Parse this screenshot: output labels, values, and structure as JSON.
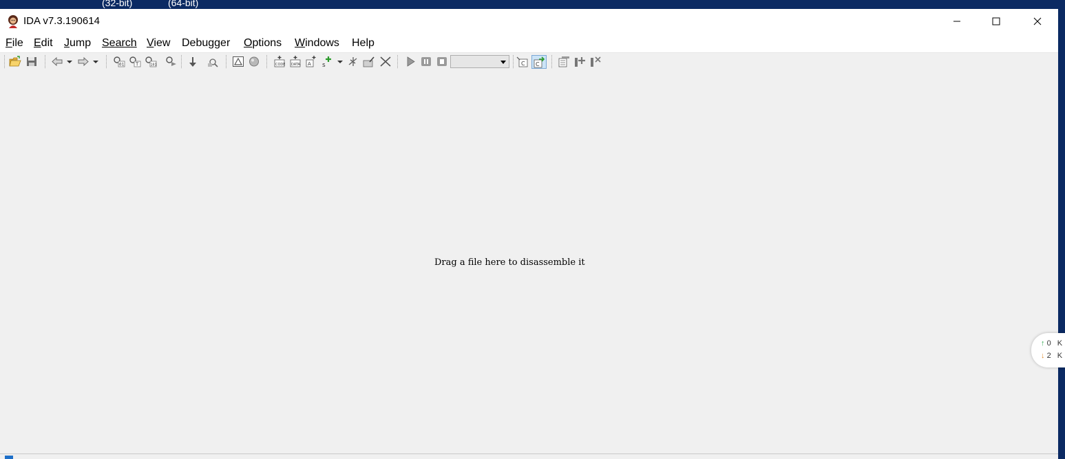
{
  "desktop": {
    "labels": [
      "(32-bit)",
      "(64-bit)"
    ]
  },
  "window": {
    "title": "IDA v7.3.190614",
    "controls": {
      "minimize": "—",
      "maximize": "☐",
      "close": "✕"
    }
  },
  "menu": {
    "items": [
      {
        "label": "File",
        "accel": "F",
        "rest": "ile"
      },
      {
        "label": "Edit",
        "accel": "E",
        "rest": "dit"
      },
      {
        "label": "Jump",
        "accel": "J",
        "rest": "ump"
      },
      {
        "label": "Search",
        "accel": "",
        "rest": "Search"
      },
      {
        "label": "View",
        "accel": "V",
        "rest": "iew"
      },
      {
        "label": "Debugger",
        "accel": "",
        "rest": "Debugger"
      },
      {
        "label": "Options",
        "accel": "O",
        "rest": "ptions"
      },
      {
        "label": "Windows",
        "accel": "W",
        "rest": "indows"
      },
      {
        "label": "Help",
        "accel": "",
        "rest": "Help"
      }
    ]
  },
  "toolbar": {
    "debugger_select": {
      "value": ""
    },
    "icons": [
      "open-icon",
      "save-icon",
      "back-icon",
      "back-dropdown-icon",
      "forward-icon",
      "forward-dropdown-icon",
      "search-hex-icon",
      "search-text-icon",
      "search-immediate-icon",
      "search-next-icon",
      "jump-down-icon",
      "find-icon",
      "graph-view-icon",
      "circle-icon",
      "code-icon",
      "data-icon",
      "string-icon",
      "add-struct-icon",
      "add-struct-dropdown-icon",
      "enum-icon",
      "patch-icon",
      "delete-icon",
      "run-icon",
      "pause-icon",
      "stop-icon",
      "pseudocode-icon",
      "decompile-icon",
      "segments-icon",
      "add-breakpoint-icon",
      "delete-breakpoint-icon"
    ]
  },
  "content": {
    "drop_hint": "Drag a file here to disassemble it"
  },
  "net_widget": {
    "up": "0",
    "down": "2",
    "unit": "K",
    "colors": {
      "up": "#2fa84f",
      "down": "#e08a2a"
    }
  },
  "colors": {
    "window_bg": "#f0f0f0",
    "titlebar_bg": "#ffffff",
    "desktop_bg": "#0b2a63"
  }
}
